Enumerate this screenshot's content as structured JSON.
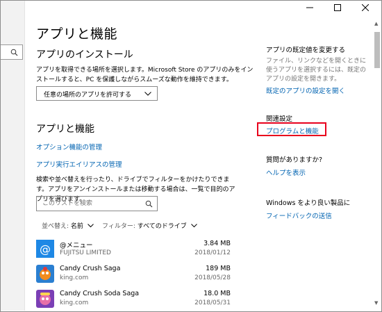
{
  "window": {
    "minimize_glyph": "—",
    "maximize_glyph": "☐",
    "close_glyph": "✕"
  },
  "page_title": "アプリと機能",
  "install": {
    "heading": "アプリのインストール",
    "description": "アプリを取得できる場所を選択します。Microsoft Store のアプリのみをインストールすると、PC を保護しながらスムーズな動作を維持できます。",
    "dropdown_value": "任意の場所のアプリを許可する"
  },
  "apps": {
    "heading": "アプリと機能",
    "link_optional_features": "オプション機能の管理",
    "link_alias": "アプリ実行エイリアスの管理",
    "description": "検索や並べ替えを行ったり、ドライブでフィルターをかけたりできます。アプリをアンインストールまたは移動する場合は、一覧で目的のアプリを選びます。",
    "search_placeholder": "このリストを検索",
    "sort_label": "並べ替え:",
    "sort_value": "名前",
    "filter_label": "フィルター:",
    "filter_value": "すべてのドライブ",
    "items": [
      {
        "name": "@メニュー",
        "publisher": "FUJITSU LIMITED",
        "size": "3.84 MB",
        "date": "2018/01/12",
        "icon": "menu-app-icon"
      },
      {
        "name": "Candy Crush Saga",
        "publisher": "king.com",
        "size": "189 MB",
        "date": "2018/05/28",
        "icon": "candy-crush-icon"
      },
      {
        "name": "Candy Crush Soda Saga",
        "publisher": "king.com",
        "size": "18.0 MB",
        "date": "2018/05/31",
        "icon": "candy-crush-soda-icon"
      }
    ]
  },
  "sidebar": {
    "defaults_heading": "アプリの既定値を変更する",
    "defaults_desc": "ファイル、リンクなどを開くときに使うアプリを選択するには、既定のアプリの設定を開きます。",
    "defaults_link": "既定のアプリの設定を開く",
    "related_heading": "関連設定",
    "related_link": "プログラムと機能",
    "question_heading": "質問がありますか?",
    "help_link": "ヘルプを表示",
    "feedback_heading": "Windows をより良い製品に",
    "feedback_link": "フィードバックの送信"
  },
  "colors": {
    "link": "#0063b1",
    "highlight": "#e8001c",
    "menu_icon_bg": "#1e88e5"
  }
}
